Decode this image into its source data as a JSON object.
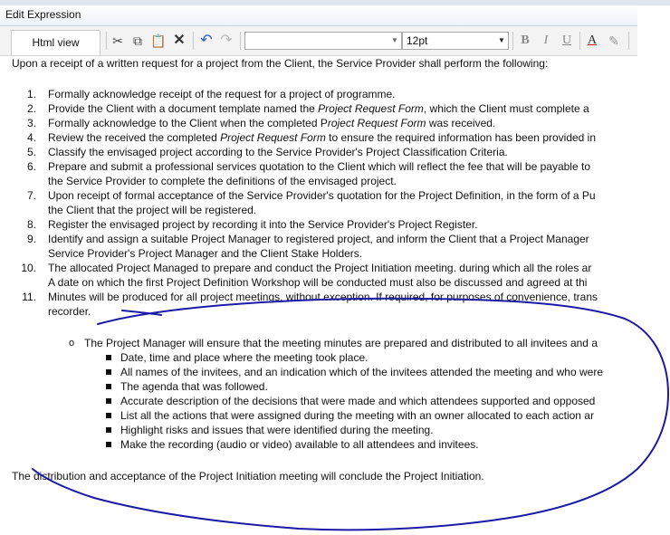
{
  "window": {
    "title": "Edit Expression"
  },
  "toolbar": {
    "html_view_label": "Html view",
    "font_name_value": "",
    "font_size_value": "12pt",
    "icons": [
      "cut-icon",
      "copy-icon",
      "paste-icon",
      "delete-icon",
      "undo-icon",
      "redo-icon",
      "bold-icon",
      "italic-icon",
      "underline-icon",
      "font-color-icon",
      "highlight-icon"
    ]
  },
  "content": {
    "intro": "Upon a receipt of a written request for a project from the Client, the Service Provider shall perform the following:",
    "items": [
      {
        "n": "1.",
        "text": "Formally acknowledge receipt of the request for a project of programme."
      },
      {
        "n": "2.",
        "pre": "Provide the Client with a document template named the ",
        "em": "Project Request Form",
        "post": ", which the Client must complete a"
      },
      {
        "n": "3.",
        "pre": "Formally acknowledge to the Client when the completed P",
        "em": "roject Request Form",
        "post": " was received."
      },
      {
        "n": "4.",
        "pre": "Review the received the completed ",
        "em": "Project Request Form",
        "post": " to ensure the required information has been provided in"
      },
      {
        "n": "5.",
        "text": "Classify the envisaged project according to the Service Provider's Project Classification Criteria."
      },
      {
        "n": "6.",
        "text": "Prepare and submit a professional services quotation to the Client which will reflect the fee that will be payable to",
        "cont": "the Service Provider to complete the definitions of the envisaged project."
      },
      {
        "n": "7.",
        "text": "Upon receipt of formal acceptance of the Service Provider's quotation for the Project Definition, in the form of a Pu",
        "cont": "the Client that the project will be registered."
      },
      {
        "n": "8.",
        "text": "Register the envisaged project by recording it into the Service Provider's Project Register."
      },
      {
        "n": "9.",
        "text": "Identify and assign a suitable Project Manager to registered project, and inform the Client that a Project Manager",
        "cont": "Service Provider's Project Manager and the Client Stake Holders."
      },
      {
        "n": "10.",
        "text": "The allocated Project Managed to prepare and conduct the Project Initiation meeting. during which all the roles ar",
        "cont": "A date on which the first Project Definition Workshop will be conducted must also be discussed and agreed at thi"
      },
      {
        "n": "11.",
        "text": "Minutes will be produced for all project meetings, without exception. If required, for purposes of convenience, trans",
        "cont": "recorder."
      }
    ],
    "sub_item": "The Project Manager will ensure that the meeting minutes are prepared and distributed to all invitees and a",
    "sub_bullets": [
      "Date, time and place where the meeting took place.",
      "All names of the invitees, and an indication which of the invitees attended the meeting and who were",
      "The agenda that was followed.",
      "Accurate description of the decisions that were made and which attendees supported and opposed",
      "List all the actions that were assigned during the meeting with an owner allocated to each action ar",
      "Highlight risks and issues that were identified during the meeting.",
      "Make the recording (audio or video) available to all attendees and invitees."
    ],
    "closing": "The distribution and acceptance of the Project Initiation meeting will conclude the Project Initiation."
  },
  "annotation": {
    "color": "#1a1aa6"
  }
}
